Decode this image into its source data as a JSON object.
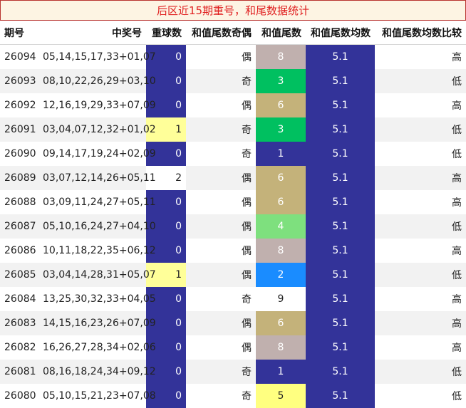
{
  "banner": "后区近15期重号，和尾数据统计",
  "headers": [
    "期号",
    "中奖号",
    "重球数",
    "和值尾数奇偶",
    "和值尾数",
    "和值尾数均数",
    "和值尾数均数比较"
  ],
  "rows": [
    {
      "period": "26094",
      "numbers": "05,14,15,17,33+01,07",
      "repeat": "0",
      "parity": "偶",
      "tail": "8",
      "avg": "5.1",
      "compare": "高",
      "tail_color": "#c0b0ae"
    },
    {
      "period": "26093",
      "numbers": "08,10,22,26,29+03,10",
      "repeat": "0",
      "parity": "奇",
      "tail": "3",
      "avg": "5.1",
      "compare": "低",
      "tail_color": "#00c060"
    },
    {
      "period": "26092",
      "numbers": "12,16,19,29,33+07,09",
      "repeat": "0",
      "parity": "偶",
      "tail": "6",
      "avg": "5.1",
      "compare": "高",
      "tail_color": "#c4b27a"
    },
    {
      "period": "26091",
      "numbers": "03,04,07,12,32+01,02",
      "repeat": "1",
      "parity": "奇",
      "tail": "3",
      "avg": "5.1",
      "compare": "低",
      "tail_color": "#00c060"
    },
    {
      "period": "26090",
      "numbers": "09,14,17,19,24+02,09",
      "repeat": "0",
      "parity": "奇",
      "tail": "1",
      "avg": "5.1",
      "compare": "低",
      "tail_color": "#333399"
    },
    {
      "period": "26089",
      "numbers": "03,07,12,14,26+05,11",
      "repeat": "2",
      "parity": "偶",
      "tail": "6",
      "avg": "5.1",
      "compare": "高",
      "tail_color": "#c4b27a"
    },
    {
      "period": "26088",
      "numbers": "03,09,11,24,27+05,11",
      "repeat": "0",
      "parity": "偶",
      "tail": "6",
      "avg": "5.1",
      "compare": "高",
      "tail_color": "#c4b27a"
    },
    {
      "period": "26087",
      "numbers": "05,10,16,24,27+04,10",
      "repeat": "0",
      "parity": "偶",
      "tail": "4",
      "avg": "5.1",
      "compare": "低",
      "tail_color": "#7ee07e"
    },
    {
      "period": "26086",
      "numbers": "10,11,18,22,35+06,12",
      "repeat": "0",
      "parity": "偶",
      "tail": "8",
      "avg": "5.1",
      "compare": "高",
      "tail_color": "#c0b0ae"
    },
    {
      "period": "26085",
      "numbers": "03,04,14,28,31+05,07",
      "repeat": "1",
      "parity": "偶",
      "tail": "2",
      "avg": "5.1",
      "compare": "低",
      "tail_color": "#1a8cff"
    },
    {
      "period": "26084",
      "numbers": "13,25,30,32,33+04,05",
      "repeat": "0",
      "parity": "奇",
      "tail": "9",
      "avg": "5.1",
      "compare": "高",
      "tail_color": "#ffffff"
    },
    {
      "period": "26083",
      "numbers": "14,15,16,23,26+07,09",
      "repeat": "0",
      "parity": "偶",
      "tail": "6",
      "avg": "5.1",
      "compare": "高",
      "tail_color": "#c4b27a"
    },
    {
      "period": "26082",
      "numbers": "16,26,27,28,34+02,06",
      "repeat": "0",
      "parity": "偶",
      "tail": "8",
      "avg": "5.1",
      "compare": "高",
      "tail_color": "#c0b0ae"
    },
    {
      "period": "26081",
      "numbers": "08,16,18,24,34+09,12",
      "repeat": "0",
      "parity": "奇",
      "tail": "1",
      "avg": "5.1",
      "compare": "低",
      "tail_color": "#333399"
    },
    {
      "period": "26080",
      "numbers": "05,10,15,21,23+07,08",
      "repeat": "0",
      "parity": "奇",
      "tail": "5",
      "avg": "5.1",
      "compare": "低",
      "tail_color": "#ffff80"
    }
  ],
  "colors": {
    "navy": "#333399",
    "banner_text": "#e02020",
    "banner_bg": "#fdf4e3",
    "yellow": "#ffff99",
    "row_alt": "#f2f2f2"
  }
}
